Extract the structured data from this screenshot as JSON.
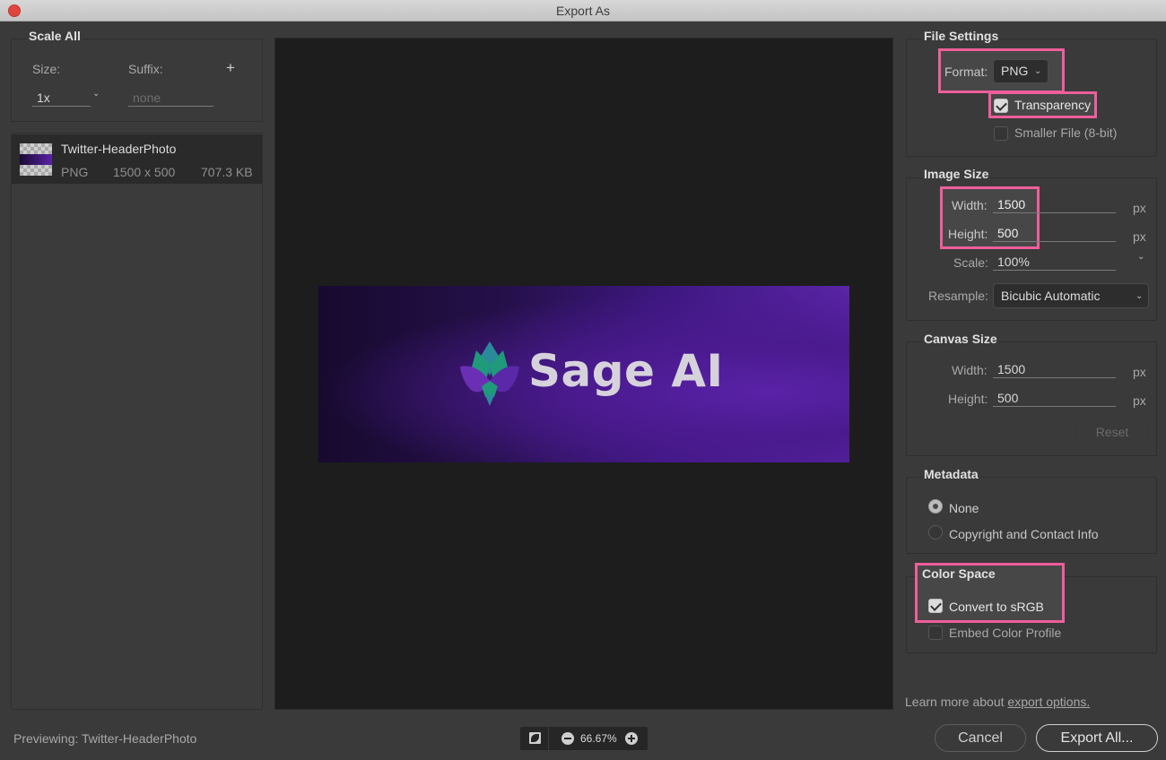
{
  "window": {
    "title": "Export As"
  },
  "scale_all": {
    "title": "Scale All",
    "size_label": "Size:",
    "size_value": "1x",
    "suffix_label": "Suffix:",
    "suffix_placeholder": "none",
    "add_label": "+"
  },
  "assets": [
    {
      "name": "Twitter-HeaderPhoto",
      "format": "PNG",
      "dimensions": "1500 x 500",
      "filesize": "707.3 KB"
    }
  ],
  "preview": {
    "banner_text": "Sage AI",
    "logo_icon": "lotus-logo"
  },
  "file_settings": {
    "title": "File Settings",
    "format_label": "Format:",
    "format_value": "PNG",
    "transparency_label": "Transparency",
    "transparency_checked": true,
    "smaller_file_label": "Smaller File (8-bit)",
    "smaller_file_checked": false
  },
  "image_size": {
    "title": "Image Size",
    "width_label": "Width:",
    "width_value": "1500",
    "height_label": "Height:",
    "height_value": "500",
    "unit": "px",
    "scale_label": "Scale:",
    "scale_value": "100%",
    "resample_label": "Resample:",
    "resample_value": "Bicubic Automatic"
  },
  "canvas_size": {
    "title": "Canvas Size",
    "width_label": "Width:",
    "width_value": "1500",
    "height_label": "Height:",
    "height_value": "500",
    "unit": "px",
    "reset_label": "Reset"
  },
  "metadata": {
    "title": "Metadata",
    "options": [
      {
        "label": "None",
        "selected": true
      },
      {
        "label": "Copyright and Contact Info",
        "selected": false
      }
    ]
  },
  "color_space": {
    "title": "Color Space",
    "convert_label": "Convert to sRGB",
    "convert_checked": true,
    "embed_label": "Embed Color Profile",
    "embed_checked": false
  },
  "footer": {
    "learn_more_prefix": "Learn more about",
    "learn_more_link": "export options.",
    "previewing_label": "Previewing:",
    "previewing_name": "Twitter-HeaderPhoto",
    "zoom_value": "66.67%",
    "cancel_label": "Cancel",
    "export_label": "Export All..."
  },
  "colors": {
    "highlight": "#ef5e9b",
    "background": "#3a3a3a",
    "preview_bg": "#1d1d1d"
  }
}
